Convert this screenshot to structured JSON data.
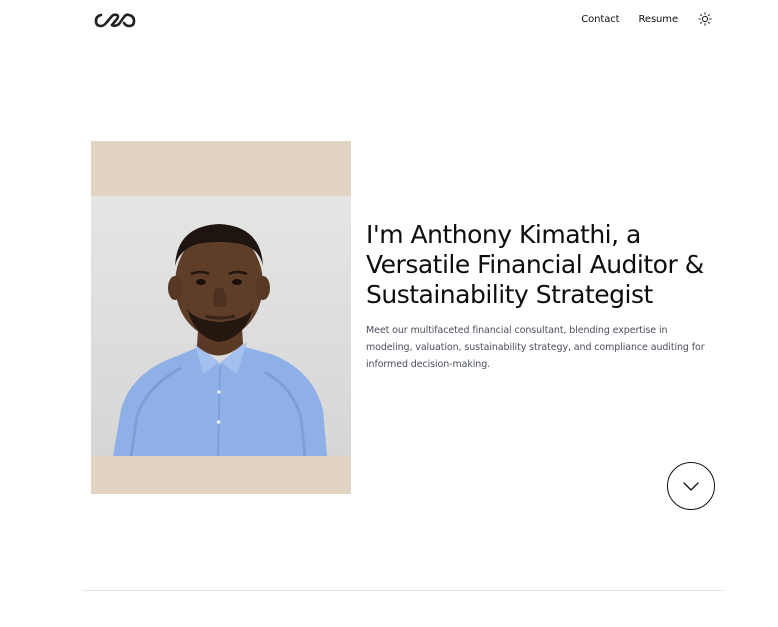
{
  "header": {
    "logo_name": "infinity-logo",
    "nav": {
      "contact_label": "Contact",
      "resume_label": "Resume"
    },
    "theme_toggle_icon": "sun-icon"
  },
  "hero": {
    "title": "I'm Anthony Kimathi, a Versatile Financial Auditor & Sustainability Strategist",
    "description": "Meet our multifaceted financial consultant, blending expertise in modeling, valuation, sustainability strategy, and compliance auditing for informed decision-making.",
    "photo_alt": "Portrait of Anthony Kimathi",
    "scroll_icon": "chevron-down-icon"
  },
  "colors": {
    "background": "#ffffff",
    "photo_frame": "#e1d4c3",
    "shirt": "#8fb0e6",
    "text": "#0d0d0d",
    "muted_text": "#4a4f5a"
  }
}
